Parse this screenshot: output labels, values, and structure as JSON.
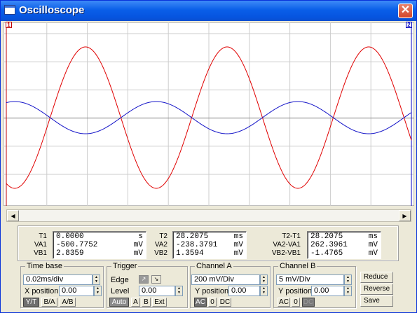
{
  "window": {
    "title": "Oscilloscope",
    "close": "✕"
  },
  "markers": {
    "a": "1",
    "b": "2"
  },
  "measurements": {
    "col1": {
      "rows": [
        {
          "label": "T1",
          "value": "0.0000",
          "unit": "s"
        },
        {
          "label": "VA1",
          "value": "-500.7752",
          "unit": "mV"
        },
        {
          "label": "VB1",
          "value": "2.8359",
          "unit": "mV"
        }
      ]
    },
    "col2": {
      "rows": [
        {
          "label": "T2",
          "value": "28.2075",
          "unit": "ms"
        },
        {
          "label": "VA2",
          "value": "-238.3791",
          "unit": "mV"
        },
        {
          "label": "VB2",
          "value": "1.3594",
          "unit": "mV"
        }
      ]
    },
    "col3": {
      "rows": [
        {
          "label": "T2-T1",
          "value": "28.2075",
          "unit": "ms"
        },
        {
          "label": "VA2-VA1",
          "value": "262.3961",
          "unit": "mV"
        },
        {
          "label": "VB2-VB1",
          "value": "-1.4765",
          "unit": "mV"
        }
      ]
    }
  },
  "timebase": {
    "title": "Time base",
    "scale": "0.02ms/div",
    "xpos_label": "X position",
    "xpos": "0.00",
    "modes": [
      "Y/T",
      "B/A",
      "A/B"
    ]
  },
  "trigger": {
    "title": "Trigger",
    "edge_label": "Edge",
    "level_label": "Level",
    "level": "0.00",
    "buttons": [
      "Auto",
      "A",
      "B",
      "Ext"
    ]
  },
  "channel_a": {
    "title": "Channel A",
    "scale": "200 mV/Div",
    "ypos_label": "Y position",
    "ypos": "0.00",
    "coupling": [
      "AC",
      "0",
      "DC"
    ]
  },
  "channel_b": {
    "title": "Channel B",
    "scale": "5 mV/Div",
    "ypos_label": "Y position",
    "ypos": "0.00",
    "coupling": [
      "AC",
      "0",
      "DC"
    ]
  },
  "actions": {
    "reduce": "Reduce",
    "reverse": "Reverse",
    "save": "Save"
  },
  "traces": {
    "a_color": "#e00000",
    "b_color": "#1414c8",
    "grid_color": "#cccccc",
    "axis_color": "#808080",
    "cursor_color": "#c00000"
  }
}
